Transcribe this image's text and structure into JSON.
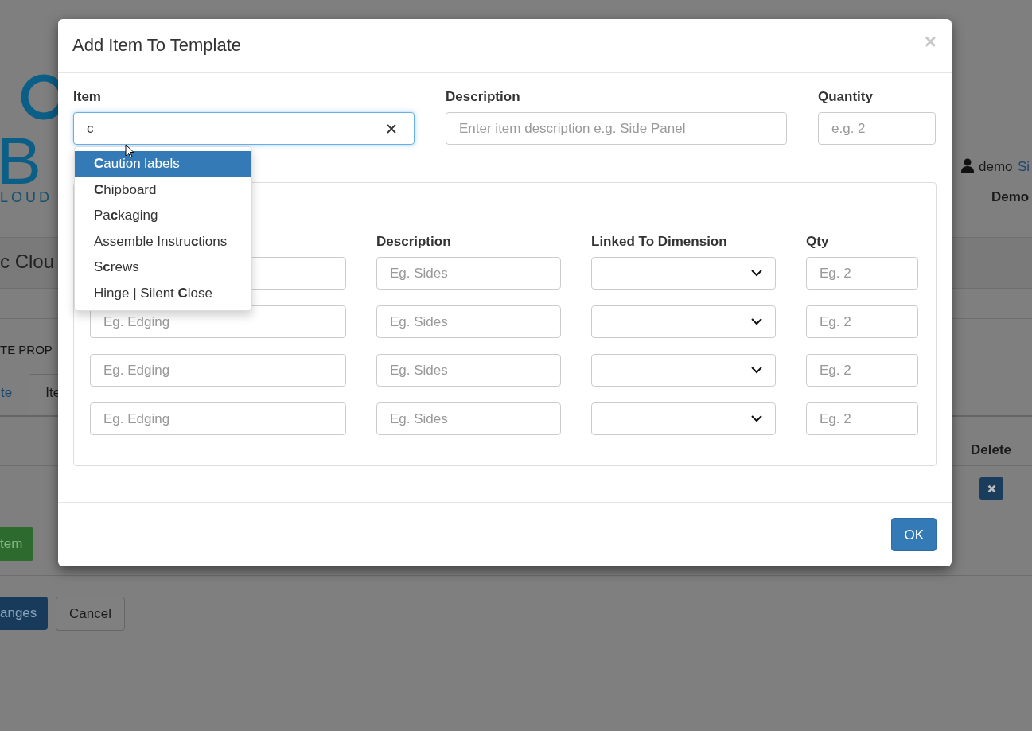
{
  "background": {
    "logo": {
      "letters": "B",
      "tagline": "LOUD"
    },
    "user": {
      "name": "demo",
      "link": "Si"
    },
    "header_label": "Demo",
    "page_title": "c Clou",
    "section_label": "TE PROP",
    "tabs": [
      {
        "label": "te",
        "selected": false
      },
      {
        "label": "Ite",
        "selected": true
      }
    ],
    "table": {
      "column": "Delete"
    },
    "add_button": "tem",
    "save_button": "anges",
    "cancel_button": "Cancel"
  },
  "modal": {
    "title": "Add Item To Template",
    "close": "×",
    "fields": [
      {
        "label": "Item",
        "value": "c",
        "clearable": true
      },
      {
        "label": "Description",
        "placeholder": "Enter item description e.g. Side Panel"
      },
      {
        "label": "Quantity",
        "placeholder": "e.g. 2"
      }
    ],
    "suggestions": [
      {
        "text": "**C**aution labels",
        "selected": true
      },
      {
        "text": "**C**hipboard",
        "selected": false
      },
      {
        "text": "Pa**c**kaging",
        "selected": false
      },
      {
        "text": "Assemble Instru**c**tions",
        "selected": false
      },
      {
        "text": "S**c**rews",
        "selected": false
      },
      {
        "text": "Hinge | Silent **C**lose",
        "selected": false
      }
    ],
    "components": {
      "columns": [
        "Description",
        "Linked To Dimension",
        "Qty"
      ],
      "rows": [
        {
          "description_placeholder": "Eg. Sides",
          "quantity_placeholder": "Eg. 2"
        },
        {
          "item_placeholder": "Eg. Edging",
          "description_placeholder": "Eg. Sides",
          "quantity_placeholder": "Eg. 2"
        },
        {
          "item_placeholder": "Eg. Edging",
          "description_placeholder": "Eg. Sides",
          "quantity_placeholder": "Eg. 2"
        },
        {
          "item_placeholder": "Eg. Edging",
          "description_placeholder": "Eg. Sides",
          "quantity_placeholder": "Eg. 2"
        }
      ]
    },
    "ok_button": "OK"
  }
}
